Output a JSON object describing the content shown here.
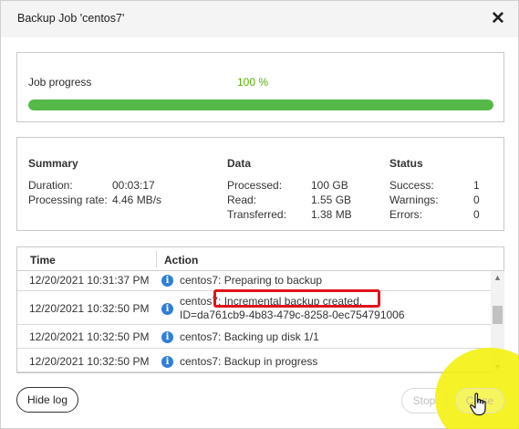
{
  "window": {
    "title": "Backup Job 'centos7'",
    "close_glyph": "✕"
  },
  "progress": {
    "label": "Job progress",
    "percent_text": "100 %",
    "fraction": 1.0,
    "color": "#54b948"
  },
  "summary": {
    "heading": "Summary",
    "duration_label": "Duration:",
    "duration_value": "00:03:17",
    "rate_label": "Processing rate:",
    "rate_value": "4.46 MB/s"
  },
  "data": {
    "heading": "Data",
    "processed_label": "Processed:",
    "processed_value": "100 GB",
    "read_label": "Read:",
    "read_value": "1.55 GB",
    "transferred_label": "Transferred:",
    "transferred_value": "1.38 MB"
  },
  "status": {
    "heading": "Status",
    "success_label": "Success:",
    "success_value": "1",
    "warnings_label": "Warnings:",
    "warnings_value": "0",
    "errors_label": "Errors:",
    "errors_value": "0"
  },
  "log": {
    "col_time": "Time",
    "col_action": "Action",
    "rows": [
      {
        "time": "12/20/2021 10:31:37 PM",
        "action": "centos7: Preparing to backup",
        "action2": "",
        "icon": "info-icon"
      },
      {
        "time": "12/20/2021 10:32:50 PM",
        "action": "centos7: Incremental backup created.",
        "action2": "ID=da761cb9-4b83-479c-8258-0ec754791006",
        "icon": "info-icon"
      },
      {
        "time": "12/20/2021 10:32:50 PM",
        "action": "centos7: Backing up disk 1/1",
        "action2": "",
        "icon": "info-icon"
      },
      {
        "time": "12/20/2021 10:32:50 PM",
        "action": "centos7: Backup in progress",
        "action2": "",
        "icon": "info-icon"
      }
    ]
  },
  "buttons": {
    "hide_log": "Hide log",
    "stop": "Stop",
    "close": "Close"
  },
  "highlight_color": "#e0141b"
}
